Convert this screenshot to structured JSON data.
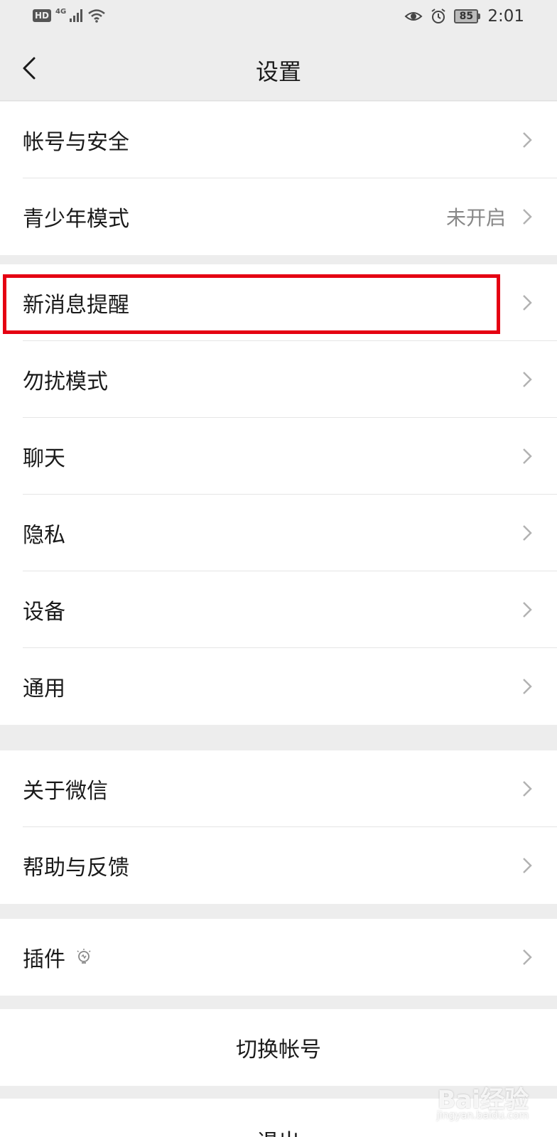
{
  "status_bar": {
    "hd_badge": "HD",
    "network": "4G",
    "battery": "85",
    "time": "2:01"
  },
  "nav": {
    "title": "设置"
  },
  "groups": [
    {
      "items": [
        {
          "label": "帐号与安全",
          "value": ""
        },
        {
          "label": "青少年模式",
          "value": "未开启"
        }
      ]
    },
    {
      "items": [
        {
          "label": "新消息提醒",
          "value": ""
        },
        {
          "label": "勿扰模式",
          "value": ""
        },
        {
          "label": "聊天",
          "value": ""
        },
        {
          "label": "隐私",
          "value": ""
        },
        {
          "label": "设备",
          "value": ""
        },
        {
          "label": "通用",
          "value": ""
        }
      ]
    },
    {
      "items": [
        {
          "label": "关于微信",
          "value": ""
        },
        {
          "label": "帮助与反馈",
          "value": ""
        }
      ]
    },
    {
      "items": [
        {
          "label": "插件",
          "value": "",
          "icon": "lightbulb-icon"
        }
      ]
    }
  ],
  "actions": {
    "switch_account": "切换帐号",
    "logout": "退出"
  },
  "watermark": {
    "brand": "Bai经验",
    "url": "jingyan.baidu.com"
  },
  "colors": {
    "highlight": "#e50012",
    "background": "#ededed",
    "row_background": "#ffffff"
  }
}
